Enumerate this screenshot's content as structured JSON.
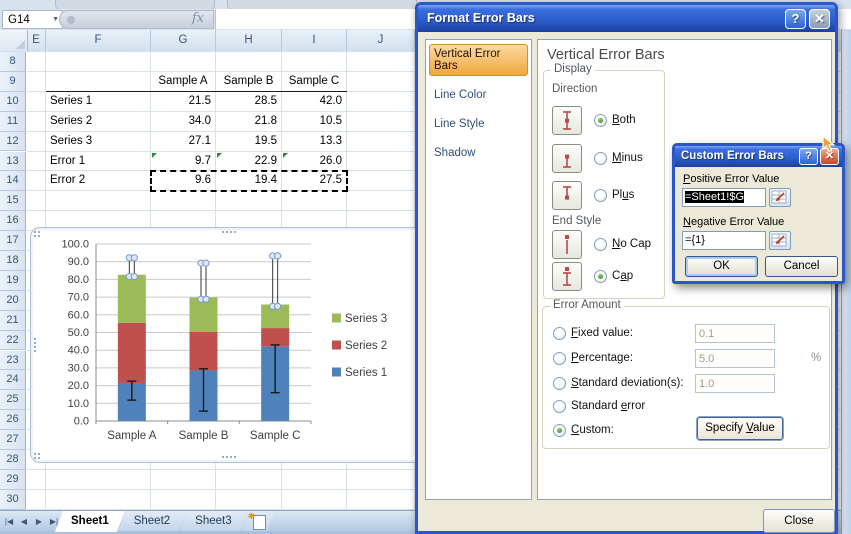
{
  "formula_bar": {
    "name_box": "G14",
    "fx_label": "fx",
    "formula_value": ""
  },
  "grid": {
    "first_row": 8,
    "last_row": 30,
    "columns": [
      "E",
      "F",
      "G",
      "H",
      "I",
      "J"
    ],
    "cells": [
      {
        "r": 9,
        "c": "G",
        "t": "Sample A",
        "align": "center"
      },
      {
        "r": 9,
        "c": "H",
        "t": "Sample B",
        "align": "center"
      },
      {
        "r": 9,
        "c": "I",
        "t": "Sample C",
        "align": "center"
      },
      {
        "r": 10,
        "c": "F",
        "t": "Series 1",
        "align": "left"
      },
      {
        "r": 10,
        "c": "G",
        "t": "21.5",
        "align": "right"
      },
      {
        "r": 10,
        "c": "H",
        "t": "28.5",
        "align": "right"
      },
      {
        "r": 10,
        "c": "I",
        "t": "42.0",
        "align": "right"
      },
      {
        "r": 11,
        "c": "F",
        "t": "Series 2",
        "align": "left"
      },
      {
        "r": 11,
        "c": "G",
        "t": "34.0",
        "align": "right"
      },
      {
        "r": 11,
        "c": "H",
        "t": "21.8",
        "align": "right"
      },
      {
        "r": 11,
        "c": "I",
        "t": "10.5",
        "align": "right"
      },
      {
        "r": 12,
        "c": "F",
        "t": "Series 3",
        "align": "left"
      },
      {
        "r": 12,
        "c": "G",
        "t": "27.1",
        "align": "right"
      },
      {
        "r": 12,
        "c": "H",
        "t": "19.5",
        "align": "right"
      },
      {
        "r": 12,
        "c": "I",
        "t": "13.3",
        "align": "right"
      },
      {
        "r": 13,
        "c": "F",
        "t": "Error 1",
        "align": "left"
      },
      {
        "r": 13,
        "c": "G",
        "t": "9.7",
        "align": "right",
        "flag": true
      },
      {
        "r": 13,
        "c": "H",
        "t": "22.9",
        "align": "right",
        "flag": true
      },
      {
        "r": 13,
        "c": "I",
        "t": "26.0",
        "align": "right",
        "flag": true
      },
      {
        "r": 14,
        "c": "F",
        "t": "Error 2",
        "align": "left"
      },
      {
        "r": 14,
        "c": "G",
        "t": "9.6",
        "align": "right"
      },
      {
        "r": 14,
        "c": "H",
        "t": "19.4",
        "align": "right"
      },
      {
        "r": 14,
        "c": "I",
        "t": "27.5",
        "align": "right"
      }
    ],
    "selected_range": {
      "row": 14,
      "first_col": "G",
      "last_col": "I"
    },
    "header_underline": {
      "row": 9,
      "first_col": "F",
      "last_col": "I"
    }
  },
  "chart_data": {
    "type": "bar",
    "stacked": true,
    "categories": [
      "Sample A",
      "Sample B",
      "Sample C"
    ],
    "series": [
      {
        "name": "Series 1",
        "color": "#4f81bd",
        "values": [
          21.5,
          28.5,
          42.0
        ]
      },
      {
        "name": "Series 2",
        "color": "#c0504d",
        "values": [
          34.0,
          21.8,
          10.5
        ]
      },
      {
        "name": "Series 3",
        "color": "#9bbb59",
        "values": [
          27.1,
          19.5,
          13.3
        ]
      }
    ],
    "error_bars": [
      {
        "series": "Series 1",
        "minus": [
          9.7,
          22.9,
          26.0
        ],
        "plus": [
          1.0,
          1.0,
          1.0
        ],
        "end_style": "cap",
        "selected": false
      },
      {
        "series": "Series 3",
        "minus": [
          1.0,
          1.0,
          1.0
        ],
        "plus": [
          9.6,
          19.4,
          27.5
        ],
        "end_style": "cap",
        "selected": true
      }
    ],
    "title": "",
    "xlabel": "",
    "ylabel": "",
    "ylim": [
      0,
      100
    ],
    "ytick_step": 10,
    "grid": true,
    "legend_position": "right",
    "legend_order": [
      "Series 3",
      "Series 2",
      "Series 1"
    ]
  },
  "sheet_tabs": {
    "nav": [
      "|◀",
      "◀",
      "▶",
      "▶|"
    ],
    "tabs": [
      {
        "label": "Sheet1",
        "active": true
      },
      {
        "label": "Sheet2",
        "active": false
      },
      {
        "label": "Sheet3",
        "active": false
      }
    ]
  },
  "format_dialog": {
    "title": "Format Error Bars",
    "help_icon": "?",
    "close_icon": "✕",
    "nav_items": [
      {
        "label": "Vertical Error Bars",
        "selected": true
      },
      {
        "label": "Line Color",
        "selected": false
      },
      {
        "label": "Line Style",
        "selected": false
      },
      {
        "label": "Shadow",
        "selected": false
      }
    ],
    "heading": "Vertical Error Bars",
    "display": {
      "label": "Display",
      "direction_label": "Direction",
      "options": [
        {
          "pre": "",
          "ul": "B",
          "post": "oth",
          "selected": true
        },
        {
          "pre": "",
          "ul": "M",
          "post": "inus",
          "selected": false
        },
        {
          "pre": "Pl",
          "ul": "u",
          "post": "s",
          "selected": false
        }
      ],
      "end_style_label": "End Style",
      "end_options": [
        {
          "pre": "",
          "ul": "N",
          "post": "o Cap",
          "selected": false
        },
        {
          "pre": "C",
          "ul": "a",
          "post": "p",
          "selected": true
        }
      ]
    },
    "error_amount": {
      "label": "Error Amount",
      "options": [
        {
          "pre": "",
          "ul": "F",
          "post": "ixed value:",
          "value": "0.1",
          "selected": false
        },
        {
          "pre": "",
          "ul": "P",
          "post": "ercentage:",
          "value": "5.0",
          "suffix": "%",
          "selected": false
        },
        {
          "pre": "",
          "ul": "S",
          "post": "tandard deviation(s):",
          "value": "1.0",
          "selected": false
        },
        {
          "pre": "Standard ",
          "ul": "e",
          "post": "rror",
          "selected": false
        },
        {
          "pre": "",
          "ul": "C",
          "post": "ustom:",
          "selected": true
        }
      ],
      "specify_button": {
        "pre": "Specify ",
        "ul": "V",
        "post": "alue"
      }
    },
    "close_button": "Close"
  },
  "custom_dialog": {
    "title": "Custom Error Bars",
    "help_icon": "?",
    "close_icon": "✕",
    "positive": {
      "pre": "",
      "ul": "P",
      "post": "ositive Error Value",
      "value": "=Sheet1!$G"
    },
    "negative": {
      "pre": "",
      "ul": "N",
      "post": "egative Error Value",
      "value": "={1}"
    },
    "ok": "OK",
    "cancel": "Cancel"
  }
}
